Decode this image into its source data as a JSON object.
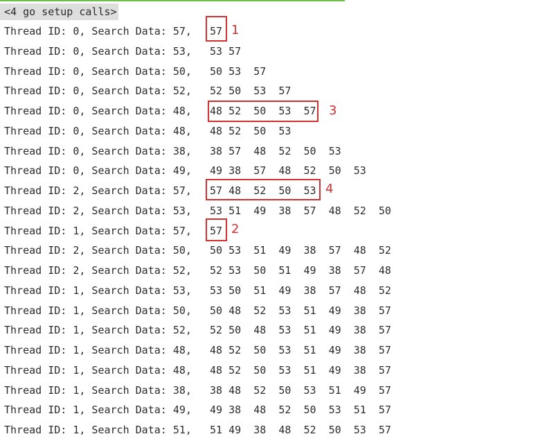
{
  "console": {
    "progress_percent": 62,
    "progress_color": "#6cc04a",
    "header": "<4 go setup calls>",
    "lines": [
      {
        "prefix": "Thread ID: 0, Search Data: 57,",
        "values": "57"
      },
      {
        "prefix": "Thread ID: 0, Search Data: 53,",
        "values": "53 57"
      },
      {
        "prefix": "Thread ID: 0, Search Data: 50,",
        "values": "50 53  57"
      },
      {
        "prefix": "Thread ID: 0, Search Data: 52,",
        "values": "52 50  53  57"
      },
      {
        "prefix": "Thread ID: 0, Search Data: 48,",
        "values": "48 52  50  53  57"
      },
      {
        "prefix": "Thread ID: 0, Search Data: 48,",
        "values": "48 52  50  53"
      },
      {
        "prefix": "Thread ID: 0, Search Data: 38,",
        "values": "38 57  48  52  50  53"
      },
      {
        "prefix": "Thread ID: 0, Search Data: 49,",
        "values": "49 38  57  48  52  50  53"
      },
      {
        "prefix": "Thread ID: 2, Search Data: 57,",
        "values": "57 48  52  50  53"
      },
      {
        "prefix": "Thread ID: 2, Search Data: 53,",
        "values": "53 51  49  38  57  48  52  50"
      },
      {
        "prefix": "Thread ID: 1, Search Data: 57,",
        "values": "57"
      },
      {
        "prefix": "Thread ID: 2, Search Data: 50,",
        "values": "50 53  51  49  38  57  48  52"
      },
      {
        "prefix": "Thread ID: 2, Search Data: 52,",
        "values": "52 53  50  51  49  38  57  48"
      },
      {
        "prefix": "Thread ID: 1, Search Data: 53,",
        "values": "53 50  51  49  38  57  48  52"
      },
      {
        "prefix": "Thread ID: 1, Search Data: 50,",
        "values": "50 48  52  53  51  49  38  57"
      },
      {
        "prefix": "Thread ID: 1, Search Data: 52,",
        "values": "52 50  48  53  51  49  38  57"
      },
      {
        "prefix": "Thread ID: 1, Search Data: 48,",
        "values": "48 52  50  53  51  49  38  57"
      },
      {
        "prefix": "Thread ID: 1, Search Data: 48,",
        "values": "48 52  50  53  51  49  38  57"
      },
      {
        "prefix": "Thread ID: 1, Search Data: 38,",
        "values": "38 48  52  50  53  51  49  57"
      },
      {
        "prefix": "Thread ID: 1, Search Data: 49,",
        "values": "49 38  48  52  50  53  51  57"
      },
      {
        "prefix": "Thread ID: 1, Search Data: 51,",
        "values": "51 49  38  48  52  50  53  57"
      }
    ]
  },
  "annotations": {
    "color": "#d32f2f",
    "labels": [
      "1",
      "2",
      "3",
      "4"
    ]
  }
}
